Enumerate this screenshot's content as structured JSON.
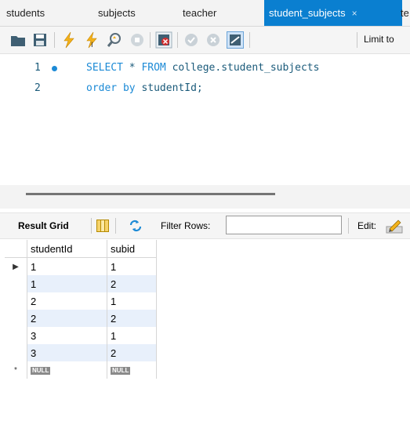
{
  "tabs": [
    {
      "label": "students",
      "active": false
    },
    {
      "label": "subjects",
      "active": false
    },
    {
      "label": "teacher",
      "active": false
    },
    {
      "label": "student_subjects",
      "active": true
    },
    {
      "label": "te",
      "active": false
    }
  ],
  "tab_close_glyph": "×",
  "toolbar": {
    "icons": [
      "folder-icon",
      "save-icon",
      "execute-icon",
      "execute-current-icon",
      "explain-icon",
      "stop-icon",
      "toggle-error-icon",
      "commit-icon",
      "rollback-icon",
      "autocommit-icon"
    ],
    "limit_label": "Limit to"
  },
  "editor": {
    "lines": [
      {
        "number": "1",
        "keyword1": "SELECT",
        "rest1": " * ",
        "keyword2": "FROM",
        "rest2": " college.student_subjects"
      },
      {
        "number": "2",
        "keyword1": "order by",
        "rest1": " studentId;"
      }
    ]
  },
  "result_bar": {
    "label": "Result Grid",
    "filter_label": "Filter Rows:",
    "filter_value": "",
    "edit_label": "Edit:"
  },
  "grid": {
    "columns": [
      "studentId",
      "subid"
    ],
    "rows": [
      [
        "1",
        "1"
      ],
      [
        "1",
        "2"
      ],
      [
        "2",
        "1"
      ],
      [
        "2",
        "2"
      ],
      [
        "3",
        "1"
      ],
      [
        "3",
        "2"
      ]
    ],
    "null_label": "NULL",
    "new_row_marker": "*",
    "current_row_marker": "▶"
  },
  "colors": {
    "accent": "#0a7fd0",
    "keyword": "#1c8ad6",
    "alt_row": "#e8f0fb"
  }
}
